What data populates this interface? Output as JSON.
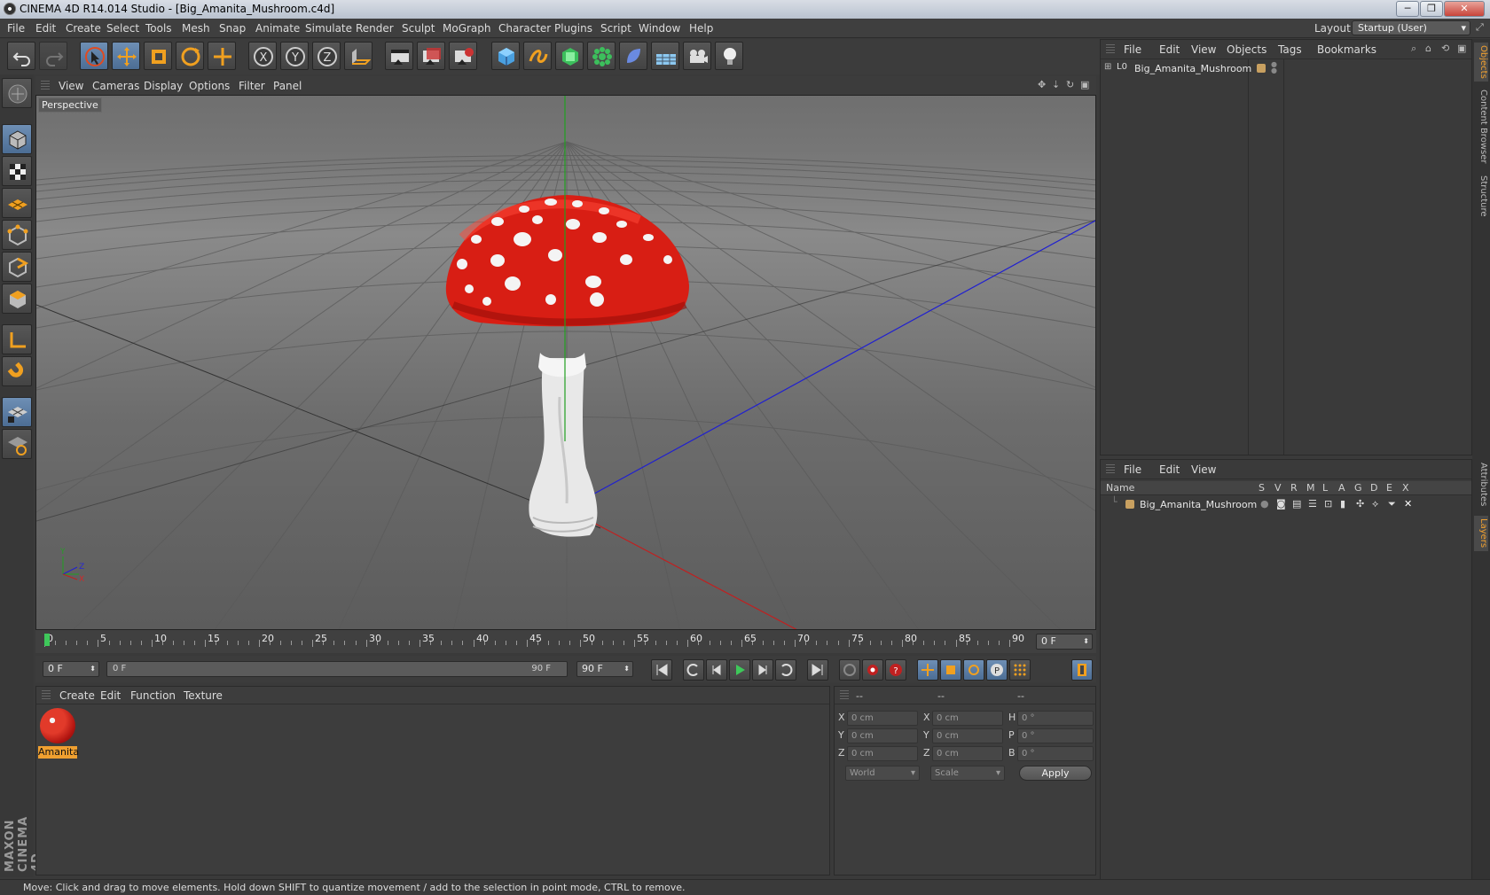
{
  "window": {
    "title": "CINEMA 4D R14.014 Studio - [Big_Amanita_Mushroom.c4d]",
    "controls": [
      "─",
      "❐",
      "✕"
    ]
  },
  "menubar": {
    "items": [
      "File",
      "Edit",
      "Create",
      "Select",
      "Tools",
      "Mesh",
      "Snap",
      "Animate",
      "Simulate",
      "Render",
      "Sculpt",
      "MoGraph",
      "Character",
      "Plugins",
      "Script",
      "Window",
      "Help"
    ],
    "layout_label": "Layout:",
    "layout_value": "Startup (User)"
  },
  "toolbar": {
    "axis_x": "X",
    "axis_y": "Y",
    "axis_z": "Z",
    "icons": [
      "undo-icon",
      "redo-icon",
      "live-selection-icon",
      "move-icon",
      "scale-icon",
      "rotate-icon",
      "add-icon",
      "x-axis-icon",
      "y-axis-icon",
      "z-axis-icon",
      "coordinate-system-icon",
      "render-view-icon",
      "render-picture-viewer-icon",
      "render-settings-icon",
      "cube-primitive-icon",
      "spline-icon",
      "nurbs-icon",
      "array-icon",
      "deformer-icon",
      "floor-icon",
      "camera-icon",
      "light-icon"
    ]
  },
  "viewport": {
    "menu": [
      "View",
      "Cameras",
      "Display",
      "Options",
      "Filter",
      "Panel"
    ],
    "label": "Perspective",
    "axis_labels": {
      "y": "Y",
      "z": "Z",
      "x": "X"
    }
  },
  "timeline": {
    "ticks": [
      "0",
      "5",
      "10",
      "15",
      "20",
      "25",
      "30",
      "35",
      "40",
      "45",
      "50",
      "55",
      "60",
      "65",
      "70",
      "75",
      "80",
      "85",
      "90"
    ],
    "current_frame_field": "0 F"
  },
  "playback": {
    "start_field": "0 F",
    "range_start": "0 F",
    "range_end": "90 F",
    "end_field": "90 F"
  },
  "material_manager": {
    "menu": [
      "Create",
      "Edit",
      "Function",
      "Texture"
    ],
    "materials": [
      {
        "name": "Amanita",
        "color": "#d81e14"
      }
    ]
  },
  "coordinates": {
    "header": [
      "--",
      "--",
      "--"
    ],
    "rows": [
      {
        "a": "X",
        "av": "0 cm",
        "b": "X",
        "bv": "0 cm",
        "c": "H",
        "cv": "0 °"
      },
      {
        "a": "Y",
        "av": "0 cm",
        "b": "Y",
        "bv": "0 cm",
        "c": "P",
        "cv": "0 °"
      },
      {
        "a": "Z",
        "av": "0 cm",
        "b": "Z",
        "bv": "0 cm",
        "c": "B",
        "cv": "0 °"
      }
    ],
    "mode_select": "World",
    "scale_select": "Scale",
    "apply_label": "Apply"
  },
  "object_manager": {
    "menu": [
      "File",
      "Edit",
      "View",
      "Objects",
      "Tags",
      "Bookmarks"
    ],
    "objects": [
      {
        "name": "Big_Amanita_Mushroom",
        "layer_color": "#c8a060"
      }
    ]
  },
  "layer_manager": {
    "menu": [
      "File",
      "Edit",
      "View"
    ],
    "columns": [
      "Name",
      "S",
      "V",
      "R",
      "M",
      "L",
      "A",
      "G",
      "D",
      "E",
      "X"
    ],
    "layers": [
      {
        "name": "Big_Amanita_Mushroom",
        "color": "#c8a060"
      }
    ]
  },
  "side_tabs": [
    "Objects",
    "Content Browser",
    "Structure",
    "Attributes",
    "Layers"
  ],
  "branding": "MAXON CINEMA 4D",
  "status": "Move: Click and drag to move elements. Hold down SHIFT to quantize movement / add to the selection in point mode, CTRL to remove.",
  "colors": {
    "accent": "#f0a030",
    "selected_tool": "#5b7ea8",
    "mushroom_cap": "#d81e14"
  }
}
